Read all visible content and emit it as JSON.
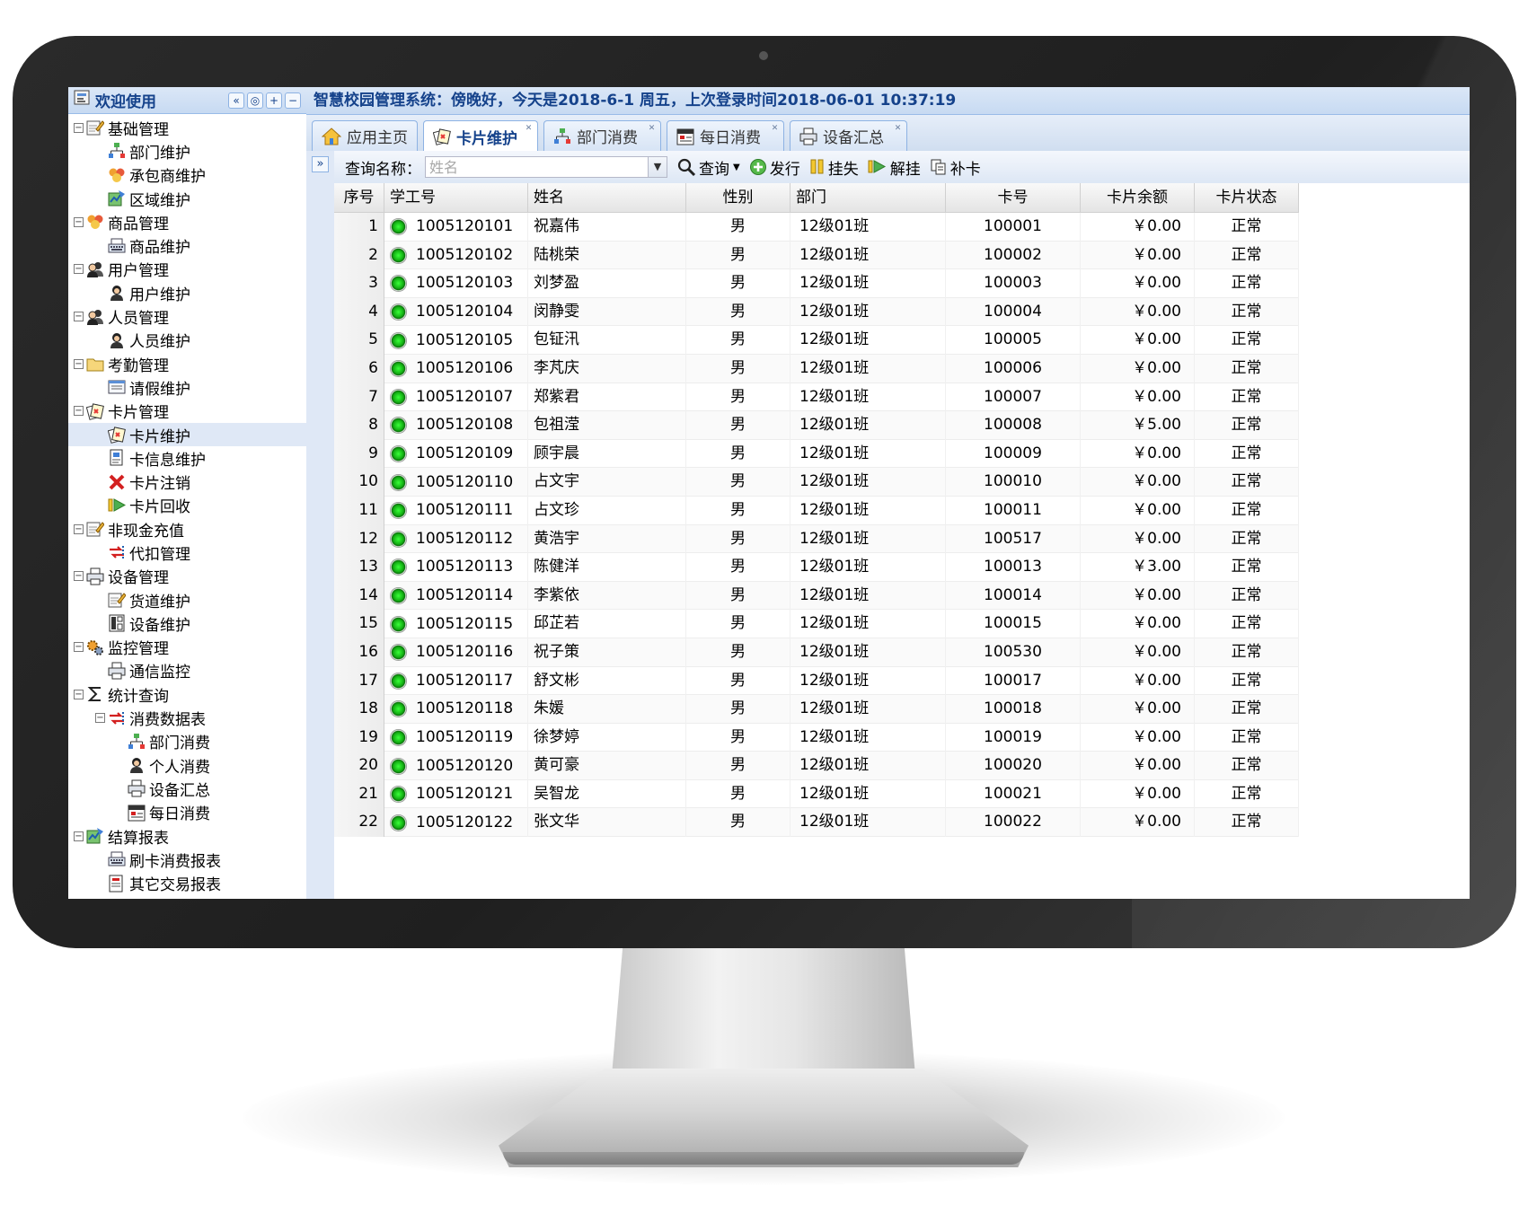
{
  "app": {
    "panel_title": "欢迎使用",
    "welcome": "智慧校园管理系统：傍晚好，今天是2018-6-1 周五，上次登录时间2018-06-01 10:37:19",
    "panel_tools": [
      "«",
      "◎",
      "+",
      "−"
    ]
  },
  "tree": [
    {
      "label": "基础管理",
      "level": 0,
      "expanded": true,
      "icon": "edit-icon"
    },
    {
      "label": "部门维护",
      "level": 1,
      "icon": "org-chart-icon"
    },
    {
      "label": "承包商维护",
      "level": 1,
      "icon": "group-icon"
    },
    {
      "label": "区域维护",
      "level": 1,
      "icon": "map-icon"
    },
    {
      "label": "商品管理",
      "level": 0,
      "expanded": true,
      "icon": "group-icon"
    },
    {
      "label": "商品维护",
      "level": 1,
      "icon": "keyboard-icon"
    },
    {
      "label": "用户管理",
      "level": 0,
      "expanded": true,
      "icon": "users-icon"
    },
    {
      "label": "用户维护",
      "level": 1,
      "icon": "user-icon"
    },
    {
      "label": "人员管理",
      "level": 0,
      "expanded": true,
      "icon": "users-icon"
    },
    {
      "label": "人员维护",
      "level": 1,
      "icon": "user-icon"
    },
    {
      "label": "考勤管理",
      "level": 0,
      "expanded": true,
      "icon": "folder-icon"
    },
    {
      "label": "请假维护",
      "level": 1,
      "icon": "form-icon"
    },
    {
      "label": "卡片管理",
      "level": 0,
      "expanded": true,
      "icon": "cards-icon"
    },
    {
      "label": "卡片维护",
      "level": 1,
      "icon": "cards-icon",
      "selected": true
    },
    {
      "label": "卡信息维护",
      "level": 1,
      "icon": "card-info-icon"
    },
    {
      "label": "卡片注销",
      "level": 1,
      "icon": "delete-icon"
    },
    {
      "label": "卡片回收",
      "level": 1,
      "icon": "recycle-icon"
    },
    {
      "label": "非现金充值",
      "level": 0,
      "expanded": true,
      "icon": "edit-icon"
    },
    {
      "label": "代扣管理",
      "level": 1,
      "icon": "transfer-icon"
    },
    {
      "label": "设备管理",
      "level": 0,
      "expanded": true,
      "icon": "printer-icon"
    },
    {
      "label": "货道维护",
      "level": 1,
      "icon": "edit-icon"
    },
    {
      "label": "设备维护",
      "level": 1,
      "icon": "device-icon"
    },
    {
      "label": "监控管理",
      "level": 0,
      "expanded": true,
      "icon": "gears-icon"
    },
    {
      "label": "通信监控",
      "level": 1,
      "icon": "printer-icon"
    },
    {
      "label": "统计查询",
      "level": 0,
      "expanded": true,
      "icon": "sigma-icon"
    },
    {
      "label": "消费数据表",
      "level": 1,
      "expanded": true,
      "icon": "transfer-icon"
    },
    {
      "label": "部门消费",
      "level": 2,
      "icon": "org-chart-icon"
    },
    {
      "label": "个人消费",
      "level": 2,
      "icon": "user-icon"
    },
    {
      "label": "设备汇总",
      "level": 2,
      "icon": "printer-icon"
    },
    {
      "label": "每日消费",
      "level": 2,
      "icon": "calendar-icon"
    },
    {
      "label": "结算报表",
      "level": 0,
      "expanded": true,
      "icon": "map-icon"
    },
    {
      "label": "刷卡消费报表",
      "level": 1,
      "icon": "keyboard-icon"
    },
    {
      "label": "其它交易报表",
      "level": 1,
      "icon": "report-icon"
    }
  ],
  "tabs": [
    {
      "label": "应用主页",
      "icon": "home-icon",
      "closable": false
    },
    {
      "label": "卡片维护",
      "icon": "cards-icon",
      "closable": true,
      "active": true
    },
    {
      "label": "部门消费",
      "icon": "org-chart-icon",
      "closable": true
    },
    {
      "label": "每日消费",
      "icon": "calendar-icon",
      "closable": true
    },
    {
      "label": "设备汇总",
      "icon": "printer-icon",
      "closable": true
    }
  ],
  "toolbar": {
    "search_label": "查询名称：",
    "search_placeholder": "姓名",
    "query": "查询",
    "issue": "发行",
    "report_loss": "挂失",
    "unlock": "解挂",
    "reissue": "补卡"
  },
  "grid": {
    "columns": [
      "序号",
      "学工号",
      "姓名",
      "性别",
      "部门",
      "卡号",
      "卡片余额",
      "卡片状态"
    ],
    "rows": [
      [
        "1",
        "1005120101",
        "祝嘉伟",
        "男",
        "12级01班",
        "100001",
        "￥0.00",
        "正常"
      ],
      [
        "2",
        "1005120102",
        "陆桃荣",
        "男",
        "12级01班",
        "100002",
        "￥0.00",
        "正常"
      ],
      [
        "3",
        "1005120103",
        "刘梦盈",
        "男",
        "12级01班",
        "100003",
        "￥0.00",
        "正常"
      ],
      [
        "4",
        "1005120104",
        "闵静雯",
        "男",
        "12级01班",
        "100004",
        "￥0.00",
        "正常"
      ],
      [
        "5",
        "1005120105",
        "包钲汛",
        "男",
        "12级01班",
        "100005",
        "￥0.00",
        "正常"
      ],
      [
        "6",
        "1005120106",
        "李芃庆",
        "男",
        "12级01班",
        "100006",
        "￥0.00",
        "正常"
      ],
      [
        "7",
        "1005120107",
        "郑紫君",
        "男",
        "12级01班",
        "100007",
        "￥0.00",
        "正常"
      ],
      [
        "8",
        "1005120108",
        "包祖滢",
        "男",
        "12级01班",
        "100008",
        "￥5.00",
        "正常"
      ],
      [
        "9",
        "1005120109",
        "顾宇晨",
        "男",
        "12级01班",
        "100009",
        "￥0.00",
        "正常"
      ],
      [
        "10",
        "1005120110",
        "占文宇",
        "男",
        "12级01班",
        "100010",
        "￥0.00",
        "正常"
      ],
      [
        "11",
        "1005120111",
        "占文珍",
        "男",
        "12级01班",
        "100011",
        "￥0.00",
        "正常"
      ],
      [
        "12",
        "1005120112",
        "黄浩宇",
        "男",
        "12级01班",
        "100517",
        "￥0.00",
        "正常"
      ],
      [
        "13",
        "1005120113",
        "陈健洋",
        "男",
        "12级01班",
        "100013",
        "￥3.00",
        "正常"
      ],
      [
        "14",
        "1005120114",
        "李紫依",
        "男",
        "12级01班",
        "100014",
        "￥0.00",
        "正常"
      ],
      [
        "15",
        "1005120115",
        "邱芷若",
        "男",
        "12级01班",
        "100015",
        "￥0.00",
        "正常"
      ],
      [
        "16",
        "1005120116",
        "祝子策",
        "男",
        "12级01班",
        "100530",
        "￥0.00",
        "正常"
      ],
      [
        "17",
        "1005120117",
        "舒文彬",
        "男",
        "12级01班",
        "100017",
        "￥0.00",
        "正常"
      ],
      [
        "18",
        "1005120118",
        "朱媛",
        "男",
        "12级01班",
        "100018",
        "￥0.00",
        "正常"
      ],
      [
        "19",
        "1005120119",
        "徐梦婷",
        "男",
        "12级01班",
        "100019",
        "￥0.00",
        "正常"
      ],
      [
        "20",
        "1005120120",
        "黄可豪",
        "男",
        "12级01班",
        "100020",
        "￥0.00",
        "正常"
      ],
      [
        "21",
        "1005120121",
        "吴智龙",
        "男",
        "12级01班",
        "100021",
        "￥0.00",
        "正常"
      ],
      [
        "22",
        "1005120122",
        "张文华",
        "男",
        "12级01班",
        "100022",
        "￥0.00",
        "正常"
      ]
    ]
  }
}
